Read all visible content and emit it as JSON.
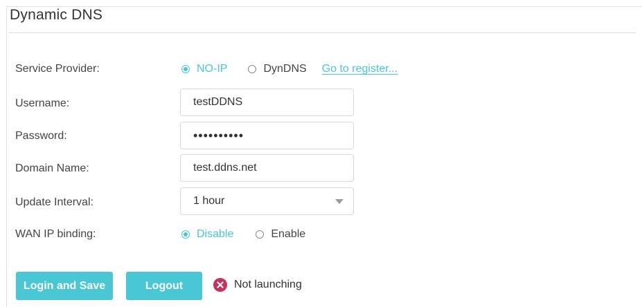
{
  "page": {
    "title": "Dynamic DNS"
  },
  "service_provider": {
    "label": "Service Provider:",
    "options": [
      {
        "label": "NO-IP",
        "selected": true
      },
      {
        "label": "DynDNS",
        "selected": false
      }
    ],
    "register_link": "Go to register..."
  },
  "username": {
    "label": "Username:",
    "value": "testDDNS"
  },
  "password": {
    "label": "Password:",
    "value": "••••••••••"
  },
  "domain_name": {
    "label": "Domain Name:",
    "value": "test.ddns.net"
  },
  "update_interval": {
    "label": "Update Interval:",
    "value": "1 hour"
  },
  "wan_ip_binding": {
    "label": "WAN IP binding:",
    "options": [
      {
        "label": "Disable",
        "selected": true
      },
      {
        "label": "Enable",
        "selected": false
      }
    ]
  },
  "actions": {
    "login_save_label": "Login and Save",
    "logout_label": "Logout"
  },
  "status": {
    "text": "Not launching",
    "icon": "error-icon"
  },
  "colors": {
    "accent": "#4ac7d4",
    "error": "#c8325a",
    "text": "#333333",
    "border": "#d9d9d9"
  }
}
